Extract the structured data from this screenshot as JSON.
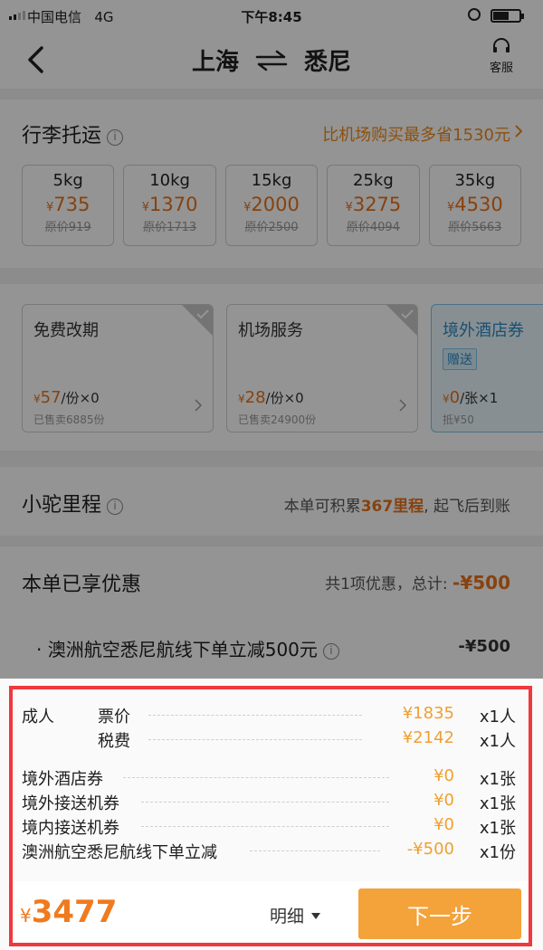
{
  "status_bar": {
    "carrier": "中国电信",
    "network": "4G",
    "time": "下午8:45"
  },
  "nav": {
    "origin": "上海",
    "destination": "悉尼",
    "service_label": "客服"
  },
  "luggage": {
    "title": "行李托运",
    "promo": "比机场购买最多省1530元",
    "currency": "¥",
    "options": [
      {
        "weight": "5kg",
        "price": "735",
        "original": "原价919"
      },
      {
        "weight": "10kg",
        "price": "1370",
        "original": "原价1713"
      },
      {
        "weight": "15kg",
        "price": "2000",
        "original": "原价2500"
      },
      {
        "weight": "25kg",
        "price": "3275",
        "original": "原价4094"
      },
      {
        "weight": "35kg",
        "price": "4530",
        "original": "原价5663"
      }
    ]
  },
  "services": [
    {
      "name": "免费改期",
      "price": "57",
      "unit": "/份×0",
      "sold": "已售卖6885份"
    },
    {
      "name": "机场服务",
      "price": "28",
      "unit": "/份×0",
      "sold": "已售卖24900份"
    },
    {
      "name": "境外酒店券",
      "gift": "赠送",
      "price": "0",
      "unit": "/张×1",
      "sold": "抵¥50"
    }
  ],
  "miles": {
    "title": "小驼里程",
    "text_before": "本单可积累",
    "value": "367里程",
    "text_after": ", 起飞后到账"
  },
  "discount": {
    "title": "本单已享优惠",
    "summary": "共1项优惠，总计: ",
    "total": "-¥500",
    "item_label": "· 澳洲航空悉尼航线下单立减500元",
    "item_value": "-¥500"
  },
  "breakdown": {
    "adult_label": "成人",
    "rows": [
      {
        "label": "票价",
        "amount": "¥1835",
        "qty": "x1人"
      },
      {
        "label": "税费",
        "amount": "¥2142",
        "qty": "x1人"
      },
      {
        "label": "境外酒店券",
        "amount": "¥0",
        "qty": "x1张"
      },
      {
        "label": "境外接送机券",
        "amount": "¥0",
        "qty": "x1张"
      },
      {
        "label": "境内接送机券",
        "amount": "¥0",
        "qty": "x1张"
      },
      {
        "label": "澳洲航空悉尼航线下单立减",
        "amount": "-¥500",
        "qty": "x1份"
      }
    ]
  },
  "footer": {
    "currency": "¥",
    "total": "3477",
    "detail_label": "明细",
    "next_label": "下一步"
  }
}
